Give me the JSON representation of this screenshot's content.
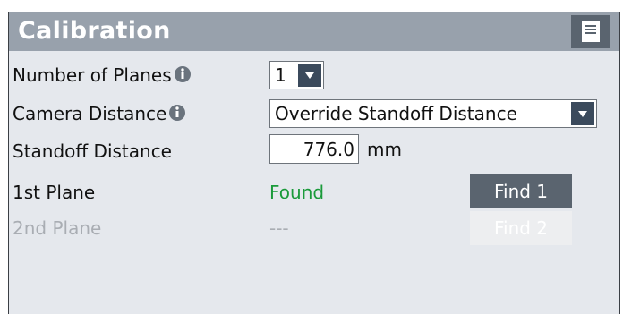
{
  "header": {
    "title": "Calibration",
    "menu_icon": "document-list-icon"
  },
  "rows": {
    "number_of_planes": {
      "label": "Number of Planes",
      "value": "1",
      "info_icon": "info-icon"
    },
    "camera_distance": {
      "label": "Camera Distance",
      "value": "Override Standoff Distance",
      "info_icon": "info-icon"
    },
    "standoff_distance": {
      "label": "Standoff Distance",
      "value": "776.0",
      "unit": "mm"
    },
    "plane1": {
      "label": "1st Plane",
      "status": "Found",
      "button": "Find 1"
    },
    "plane2": {
      "label": "2nd Plane",
      "status": "---",
      "button": "Find 2"
    }
  },
  "colors": {
    "title_bar": "#98a1ac",
    "panel": "#e5e8ed",
    "button": "#5a646f",
    "status_found": "#1a9a3a",
    "disabled_text": "#a9adb3"
  }
}
